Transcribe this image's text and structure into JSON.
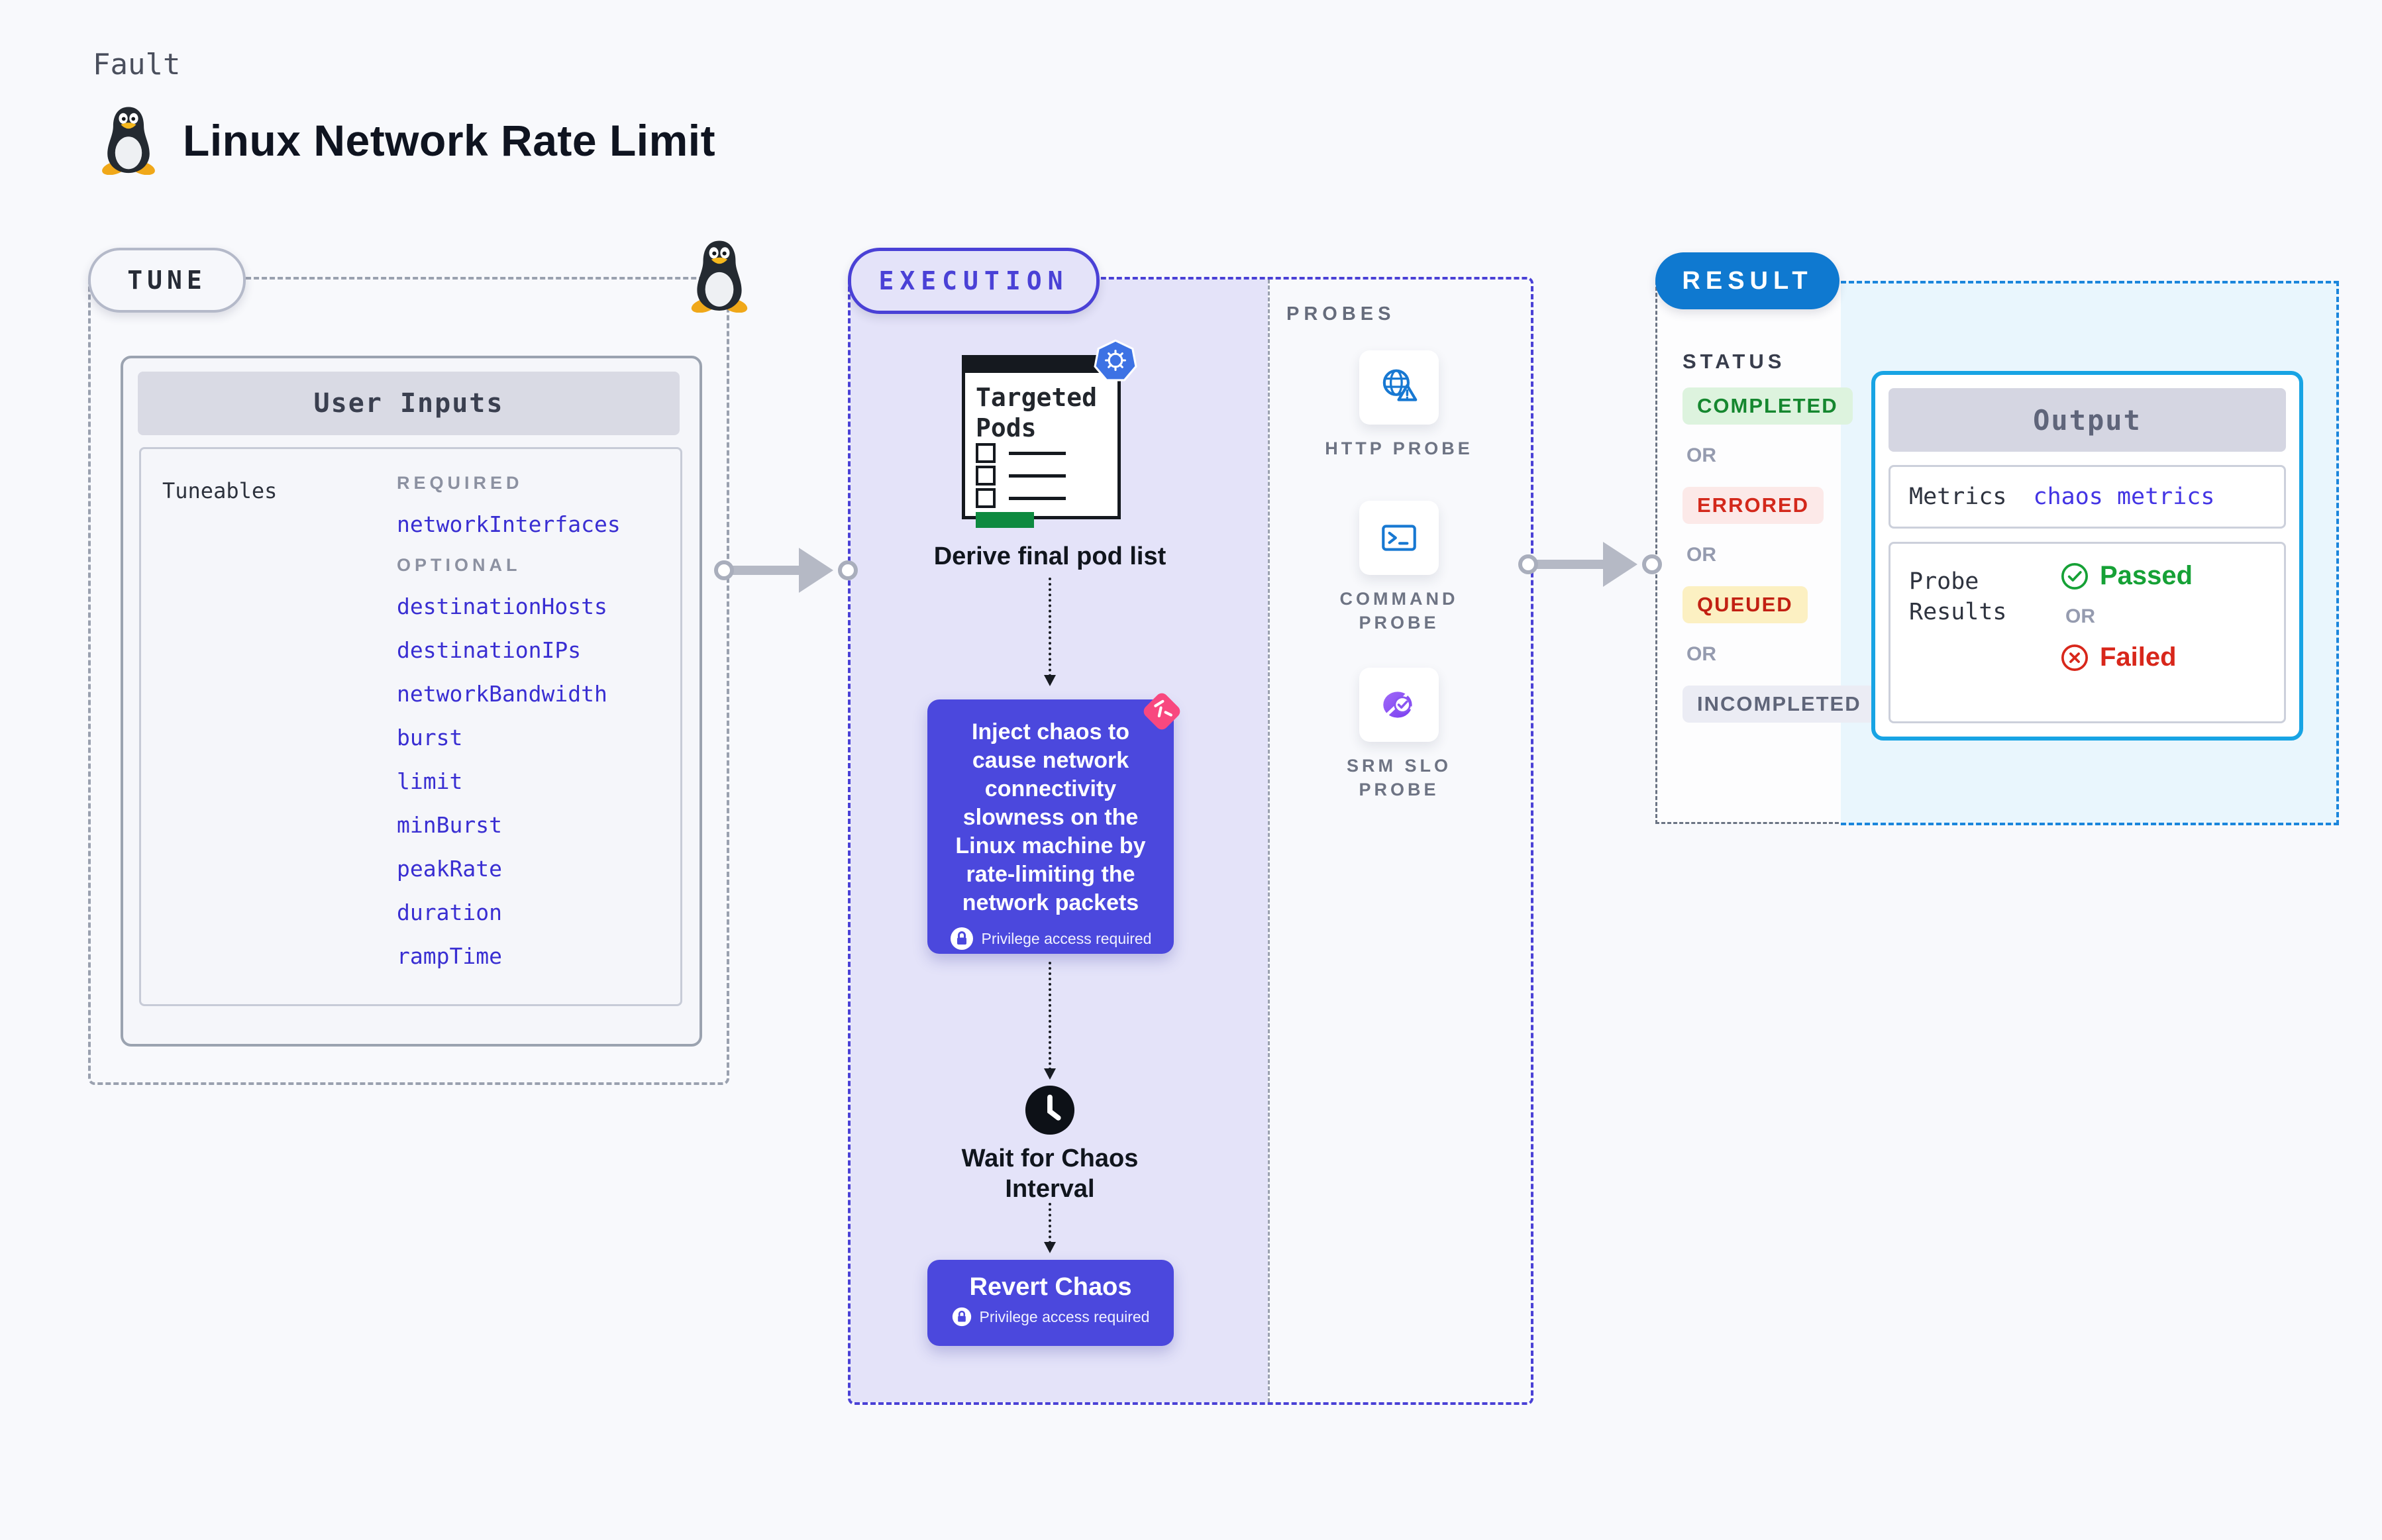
{
  "page": {
    "kicker": "Fault",
    "title": "Linux Network Rate Limit"
  },
  "tune": {
    "label": "TUNE",
    "card_title": "User Inputs",
    "tuneables_label": "Tuneables",
    "required_label": "REQUIRED",
    "optional_label": "OPTIONAL",
    "required_fields": [
      "networkInterfaces"
    ],
    "optional_fields": [
      "destinationHosts",
      "destinationIPs",
      "networkBandwidth",
      "burst",
      "limit",
      "minBurst",
      "peakRate",
      "duration",
      "rampTime"
    ]
  },
  "execution": {
    "label": "EXECUTION",
    "targeted_pods_title": "Targeted Pods",
    "derive_step": "Derive final pod list",
    "inject_step": "Inject chaos to cause network connectivity slowness on the Linux machine by rate-limiting the network packets",
    "wait_step": "Wait for Chaos Interval",
    "revert_step": "Revert Chaos",
    "privilege_note": "Privilege access required"
  },
  "probes": {
    "label": "PROBES",
    "items": [
      {
        "name": "HTTP PROBE",
        "icon": "globe-warning-icon"
      },
      {
        "name": "COMMAND PROBE",
        "icon": "terminal-icon"
      },
      {
        "name": "SRM SLO PROBE",
        "icon": "slo-donut-check-icon"
      }
    ]
  },
  "result": {
    "label": "RESULT",
    "status_label": "STATUS",
    "or_label": "OR",
    "statuses": [
      {
        "text": "COMPLETED",
        "fg": "#15872f",
        "bg": "#ddf3de"
      },
      {
        "text": "ERRORED",
        "fg": "#d3281b",
        "bg": "#fce9e8"
      },
      {
        "text": "QUEUED",
        "fg": "#c22012",
        "bg": "#fcf0c2"
      },
      {
        "text": "INCOMPLETED",
        "fg": "#5f6579",
        "bg": "#ebecf4"
      }
    ],
    "output": {
      "title": "Output",
      "metrics_label": "Metrics",
      "metrics_value": "chaos metrics",
      "probe_results_label": "Probe Results",
      "passed_label": "Passed",
      "failed_label": "Failed"
    }
  },
  "colors": {
    "page_bg": "#f8f9fc",
    "indigo": "#4b48dd",
    "lavender_panel": "#e4e3f9",
    "tune_link_blue": "#392ed2",
    "result_pill_blue": "#0f79d0",
    "result_dash_blue": "#1b86dc",
    "result_panel_bg": "#e9f6fd",
    "output_border_cyan": "#18a4e4",
    "passed_green": "#16a136",
    "failed_red": "#d8271b",
    "kubernetes_blue": "#3d72e4",
    "chaos_pink": "#f8487f",
    "pods_green": "#0e8a40",
    "probe_icon_blue": "#1778d2"
  }
}
